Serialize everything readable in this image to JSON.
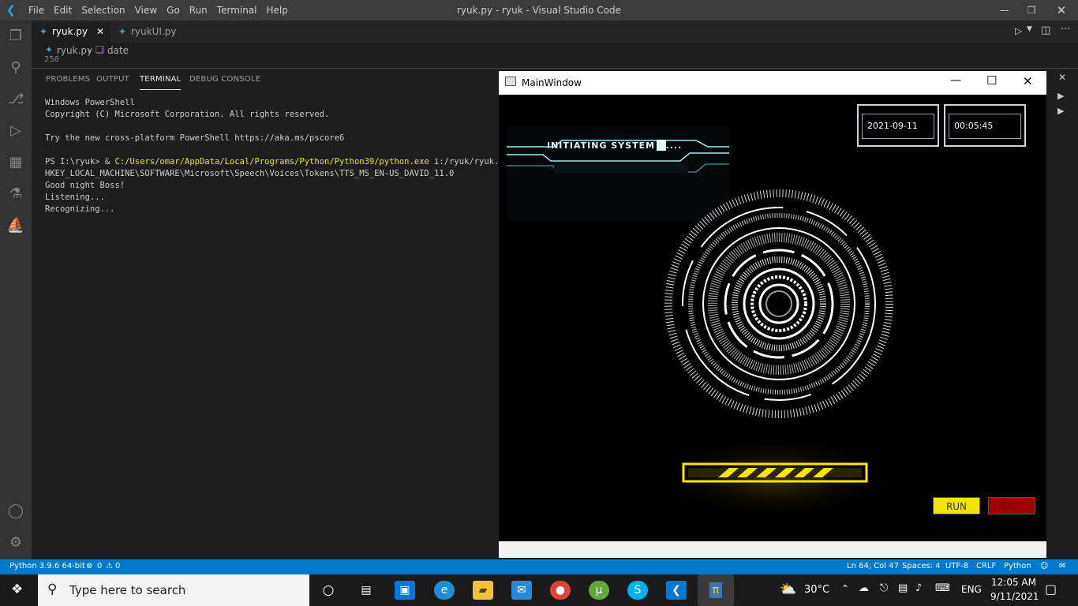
{
  "vscode": {
    "window_title": "ryuk.py - ryuk - Visual Studio Code",
    "menu": [
      "File",
      "Edit",
      "Selection",
      "View",
      "Go",
      "Run",
      "Terminal",
      "Help"
    ],
    "tabs": [
      {
        "label": "ryuk.py",
        "active": true
      },
      {
        "label": "ryukUI.py",
        "active": false
      }
    ],
    "breadcrumb": {
      "file": "ryuk.py",
      "symbol": "date",
      "line_hint": "258"
    },
    "panel_tabs": [
      "PROBLEMS",
      "OUTPUT",
      "TERMINAL",
      "DEBUG CONSOLE"
    ],
    "terminal": {
      "line1": "Windows PowerShell",
      "line2": "Copyright (C) Microsoft Corporation. All rights reserved.",
      "line3": "Try the new cross-platform PowerShell https://aka.ms/pscore6",
      "prompt": "PS I:\\ryuk> & ",
      "cmd_path": "C:/Users/omar/AppData/Local/Programs/Python/Python39/python.exe",
      "cmd_arg": " i:/ryuk/ryuk.py",
      "line5": "HKEY_LOCAL_MACHINE\\SOFTWARE\\Microsoft\\Speech\\Voices\\Tokens\\TTS_MS_EN-US_DAVID_11.0",
      "line6": "Good night Boss!",
      "line7": "Listening...",
      "line8": "Recognizing..."
    },
    "statusbar": {
      "python": "Python 3.9.6 64-bit",
      "errors": "0",
      "warnings": "0",
      "position": "Ln 64, Col 47",
      "spaces": "Spaces: 4",
      "encoding": "UTF-8",
      "eol": "CRLF",
      "language": "Python"
    }
  },
  "app_window": {
    "title": "MainWindow",
    "date": "2021-09-11",
    "time": "00:05:45",
    "banner": "INITIATING SYSTEM 1....",
    "run_label": "RUN",
    "exit_label": "EXIT",
    "run_color": "#f2e400",
    "exit_color": "#a00000",
    "hud_color": "#ffffff",
    "loader_color": "#ffe400"
  },
  "taskbar": {
    "search_placeholder": "Type here to search",
    "weather": "30°C",
    "language": "ENG",
    "clock_time": "12:05 AM",
    "clock_date": "9/11/2021"
  }
}
